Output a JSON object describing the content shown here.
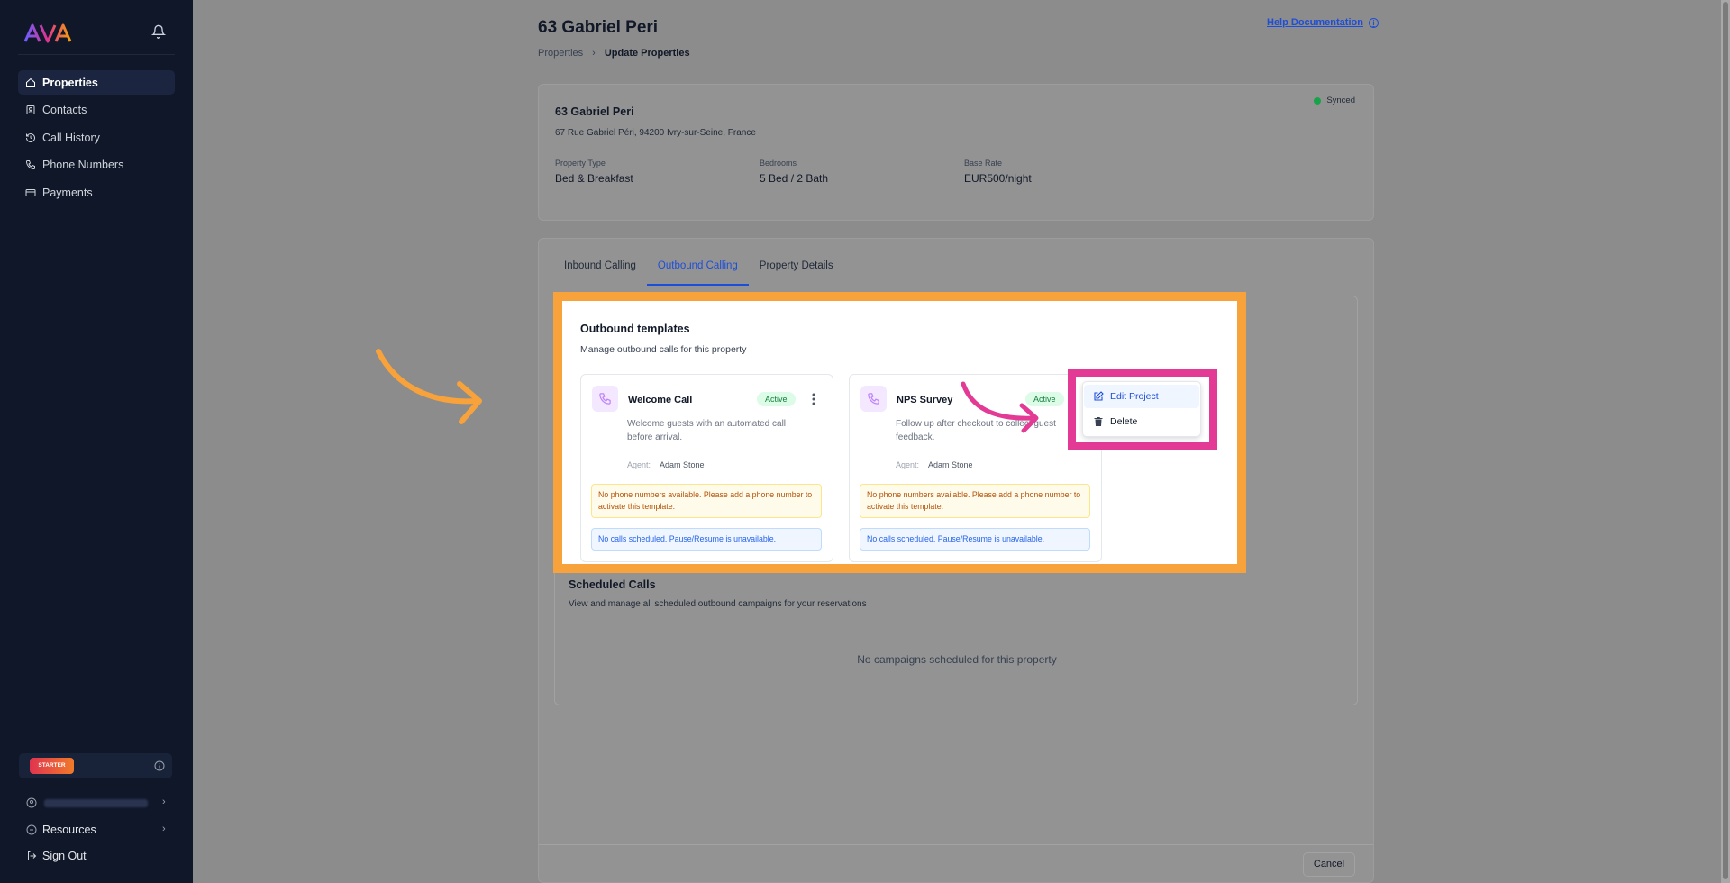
{
  "app": {
    "logo_text": "AVA"
  },
  "sidebar": {
    "nav": [
      {
        "label": "Properties",
        "icon": "home-icon",
        "active": true
      },
      {
        "label": "Contacts",
        "icon": "contacts-icon",
        "active": false
      },
      {
        "label": "Call History",
        "icon": "history-icon",
        "active": false
      },
      {
        "label": "Phone Numbers",
        "icon": "phone-icon",
        "active": false
      },
      {
        "label": "Payments",
        "icon": "card-icon",
        "active": false
      }
    ],
    "plan_badge": "STARTER",
    "resources": "Resources",
    "sign_out": "Sign Out"
  },
  "header": {
    "title": "63 Gabriel Peri",
    "breadcrumb": [
      "Properties",
      "Update Properties"
    ],
    "help": "Help Documentation"
  },
  "property": {
    "status": "Synced",
    "name": "63 Gabriel Peri",
    "address": "67 Rue Gabriel Péri, 94200 Ivry-sur-Seine, France",
    "fields": [
      {
        "label": "Property Type",
        "value": "Bed & Breakfast"
      },
      {
        "label": "Bedrooms",
        "value": "5 Bed / 2 Bath"
      },
      {
        "label": "Base Rate",
        "value": "EUR500/night"
      }
    ]
  },
  "tabs": [
    "Inbound Calling",
    "Outbound Calling",
    "Property Details"
  ],
  "outbound": {
    "title": "Outbound templates",
    "subtitle": "Manage outbound calls for this property",
    "templates": [
      {
        "name": "Welcome Call",
        "status": "Active",
        "desc": "Welcome guests with an automated call before arrival.",
        "agent_label": "Agent:",
        "agent": "Adam Stone",
        "warning": "No phone numbers available. Please add a phone number to activate this template.",
        "info": "No calls scheduled. Pause/Resume is unavailable."
      },
      {
        "name": "NPS Survey",
        "status": "Active",
        "desc": "Follow up after checkout to collect guest feedback.",
        "agent_label": "Agent:",
        "agent": "Adam Stone",
        "warning": "No phone numbers available. Please add a phone number to activate this template.",
        "info": "No calls scheduled. Pause/Resume is unavailable."
      }
    ],
    "menu": [
      {
        "label": "Edit Project",
        "icon": "edit-icon"
      },
      {
        "label": "Delete",
        "icon": "trash-icon"
      }
    ]
  },
  "scheduled": {
    "title": "Scheduled Calls",
    "subtitle": "View and manage all scheduled outbound campaigns for your reservations",
    "empty": "No campaigns scheduled for this property"
  },
  "footer": {
    "cancel": "Cancel"
  },
  "colors": {
    "highlight_orange": "#f7a23b",
    "highlight_pink": "#e33b95",
    "accent": "#1d4ed8",
    "sidebar": "#0f1729"
  }
}
